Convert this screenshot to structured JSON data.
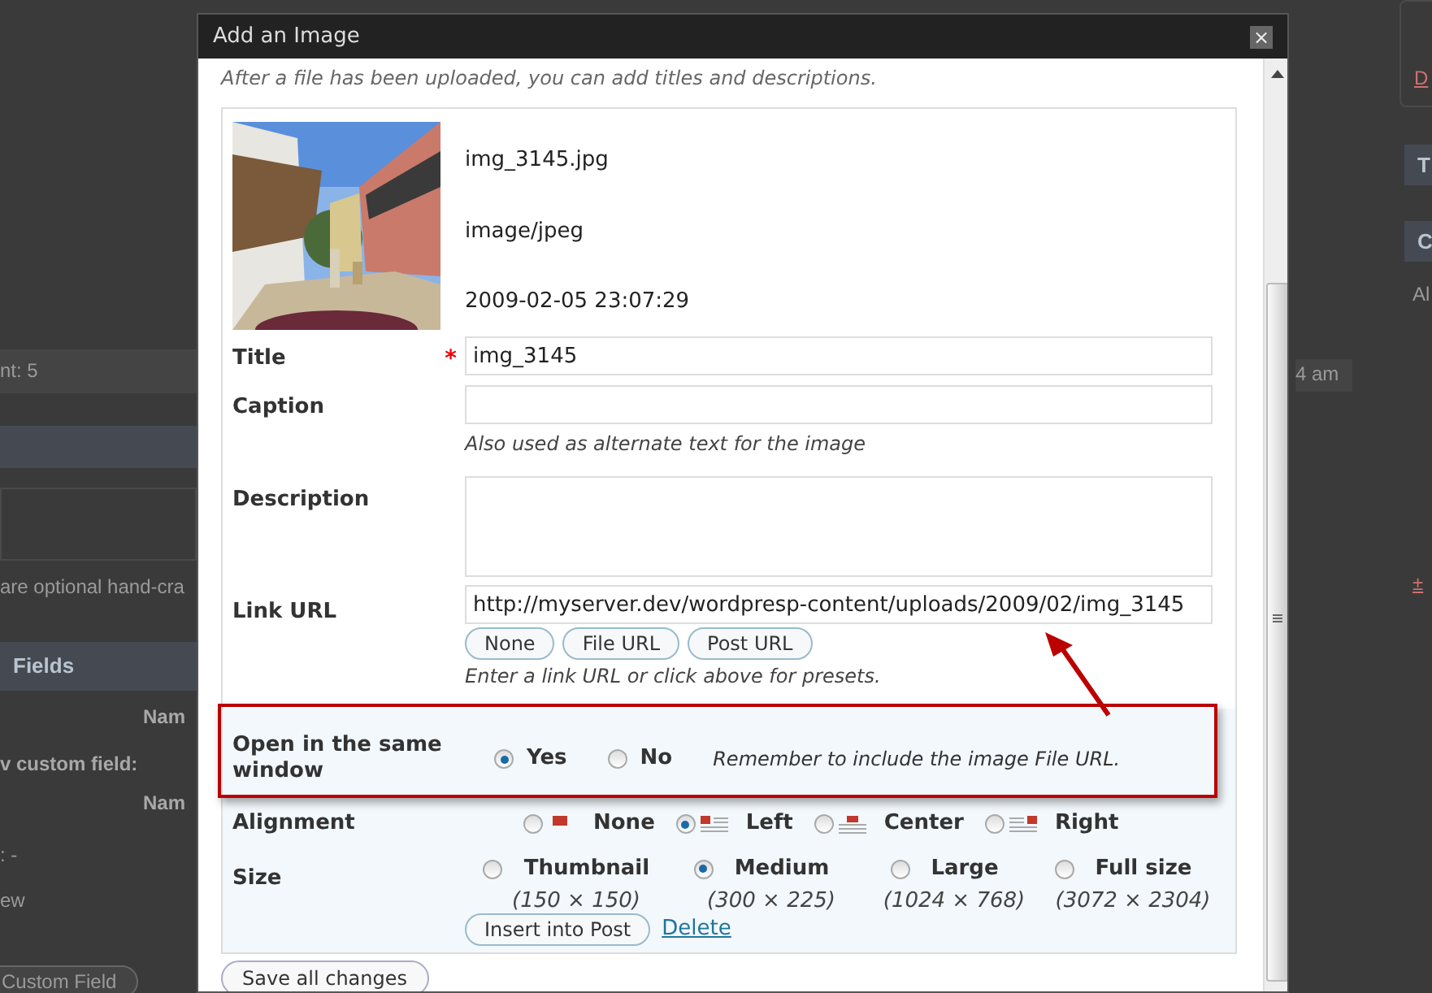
{
  "background": {
    "fragments": [
      {
        "kind": "text",
        "text": "nt: 5"
      },
      {
        "kind": "text",
        "text": "are optional hand-cra"
      },
      {
        "kind": "heading",
        "text": "Fields"
      },
      {
        "kind": "bold",
        "text": "Nam"
      },
      {
        "kind": "bold",
        "text": "v custom field:"
      },
      {
        "kind": "bold",
        "text": "Nam"
      },
      {
        "kind": "text",
        "text": ": -"
      },
      {
        "kind": "text",
        "text": "ew"
      },
      {
        "kind": "button",
        "text": "Custom Field"
      },
      {
        "kind": "text",
        "text": "4 am"
      },
      {
        "kind": "link",
        "text": "D"
      },
      {
        "kind": "heading",
        "text": "T"
      },
      {
        "kind": "heading",
        "text": "C"
      },
      {
        "kind": "text",
        "text": "Al"
      },
      {
        "kind": "link",
        "text": "±"
      }
    ]
  },
  "dialog": {
    "title": "Add an Image",
    "close": "×",
    "intro": "After a file has been uploaded, you can add titles and descriptions.",
    "file": {
      "name": "img_3145.jpg",
      "type": "image/jpeg",
      "date": "2009-02-05 23:07:29"
    },
    "title_field": {
      "label": "Title",
      "required_mark": "*",
      "value": "img_3145"
    },
    "caption_field": {
      "label": "Caption",
      "help": "Also used as alternate text for the image"
    },
    "description_field": {
      "label": "Description"
    },
    "link_url": {
      "label": "Link URL",
      "value": "http://myserver.dev/wordpresp-content/uploads/2009/02/img_3145",
      "buttons": [
        "None",
        "File URL",
        "Post URL"
      ],
      "help": "Enter a link URL or click above for presets."
    },
    "open_same_window": {
      "label": "Open in the same window",
      "options": [
        {
          "label": "Yes",
          "selected": true
        },
        {
          "label": "No",
          "selected": false
        }
      ],
      "note": "Remember to include the image File URL."
    },
    "alignment": {
      "label": "Alignment",
      "options": [
        {
          "label": "None",
          "kind": "none",
          "selected": false
        },
        {
          "label": "Left",
          "kind": "left",
          "selected": true
        },
        {
          "label": "Center",
          "kind": "center",
          "selected": false
        },
        {
          "label": "Right",
          "kind": "right",
          "selected": false
        }
      ]
    },
    "size": {
      "label": "Size",
      "options": [
        {
          "label": "Thumbnail",
          "dims": "(150 × 150)",
          "selected": false
        },
        {
          "label": "Medium",
          "dims": "(300 × 225)",
          "selected": true
        },
        {
          "label": "Large",
          "dims": "(1024 × 768)",
          "selected": false
        },
        {
          "label": "Full size",
          "dims": "(3072 × 2304)",
          "selected": false
        }
      ]
    },
    "insert_button": "Insert into Post",
    "delete_link": "Delete",
    "save_button": "Save all changes"
  }
}
